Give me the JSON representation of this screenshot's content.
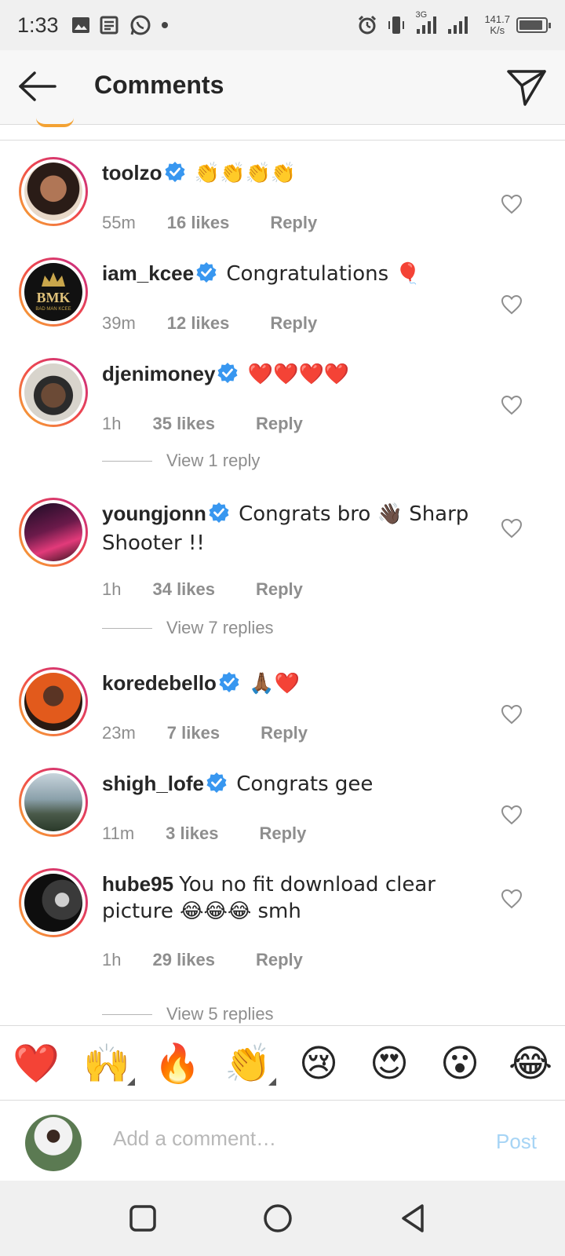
{
  "status_bar": {
    "time": "1:33",
    "network": "3G",
    "speed_value": "141.7",
    "speed_unit": "K/s",
    "battery_level": 0.9,
    "icons": [
      "image-icon",
      "news-icon",
      "whatsapp-icon",
      "dot-icon",
      "alarm-icon",
      "vibrate-icon",
      "signal-icon",
      "signal-icon",
      "battery-icon"
    ]
  },
  "header": {
    "title": "Comments",
    "back_icon": "arrow-left-icon",
    "send_icon": "paper-plane-icon"
  },
  "comments": [
    {
      "username": "toolzo",
      "verified": true,
      "text": "👏👏👏👏",
      "time": "55m",
      "likes": "16 likes",
      "reply": "Reply"
    },
    {
      "username": "iam_kcee",
      "verified": true,
      "text": "Congratulations 🎈",
      "time": "39m",
      "likes": "12 likes",
      "reply": "Reply"
    },
    {
      "username": "djenimoney",
      "verified": true,
      "text": "❤️❤️❤️❤️",
      "time": "1h",
      "likes": "35 likes",
      "reply": "Reply",
      "view_replies": "View 1 reply"
    },
    {
      "username": "youngjonn",
      "verified": true,
      "text": "Congrats bro 👋🏿 Sharp Shooter !!",
      "time": "1h",
      "likes": "34 likes",
      "reply": "Reply",
      "view_replies": "View 7 replies"
    },
    {
      "username": "koredebello",
      "verified": true,
      "text": "🙏🏾❤️",
      "time": "23m",
      "likes": "7 likes",
      "reply": "Reply"
    },
    {
      "username": "shigh_lofe",
      "verified": true,
      "text": "Congrats gee",
      "time": "11m",
      "likes": "3 likes",
      "reply": "Reply"
    },
    {
      "username": "hube95",
      "verified": false,
      "text": "You no fit download clear picture 😂😂😂 smh",
      "time": "1h",
      "likes": "29 likes",
      "reply": "Reply",
      "view_replies": "View 5 replies"
    }
  ],
  "emoji_bar": [
    "❤️",
    "🙌",
    "🔥",
    "👏",
    "😢",
    "😍",
    "😮",
    "😂"
  ],
  "composer": {
    "placeholder": "Add a comment…",
    "post_label": "Post"
  },
  "nav": [
    "square-icon",
    "circle-icon",
    "triangle-back-icon"
  ],
  "colors": {
    "verified": "#3897f0",
    "post_disabled": "#a6d4f5",
    "meta_gray": "#8e8e8e"
  }
}
